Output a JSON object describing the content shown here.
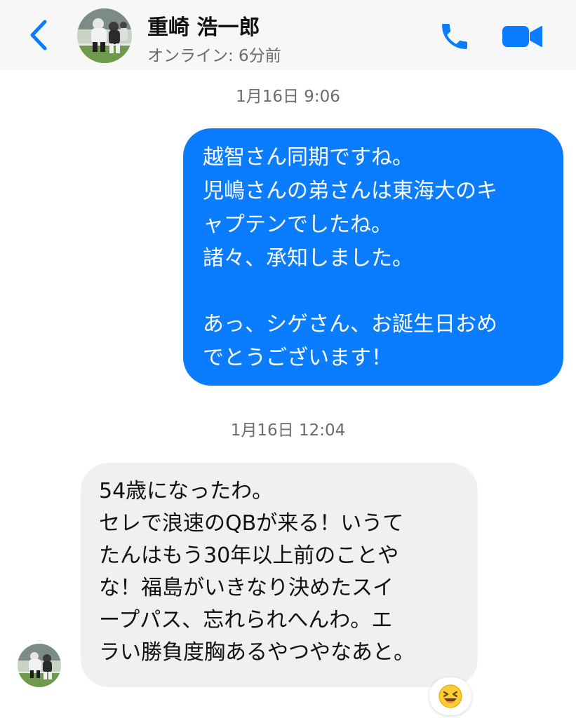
{
  "header": {
    "contact_name": "重崎 浩一郎",
    "status": "オンライン: 6分前",
    "accent_color": "#0a7cff",
    "back_icon": "chevron-left-icon",
    "call_icon": "phone-icon",
    "video_icon": "video-camera-icon"
  },
  "messages": [
    {
      "timestamp": "1月16日 9:06",
      "direction": "outgoing",
      "bubble_color": "#0a7cff",
      "lines": [
        "越智さん同期ですね。",
        "児嶋さんの弟さんは東海大のキ",
        "ャプテンでしたね。",
        "諸々、承知しました。",
        "",
        "あっ、シゲさん、お誕生日おめ",
        "でとうございます！"
      ]
    },
    {
      "timestamp": "1月16日 12:04",
      "direction": "incoming",
      "bubble_color": "#f0f0f3",
      "lines": [
        "54歳になったわ。",
        "セレで浪速のQBが来る！いうて",
        "たんはもう30年以上前のことや",
        "な！福島がいきなり決めたスイ",
        "ープパス、忘れられへんわ。エ",
        "ラい勝負度胸あるやつやなあと。"
      ],
      "reaction": "😆"
    }
  ]
}
